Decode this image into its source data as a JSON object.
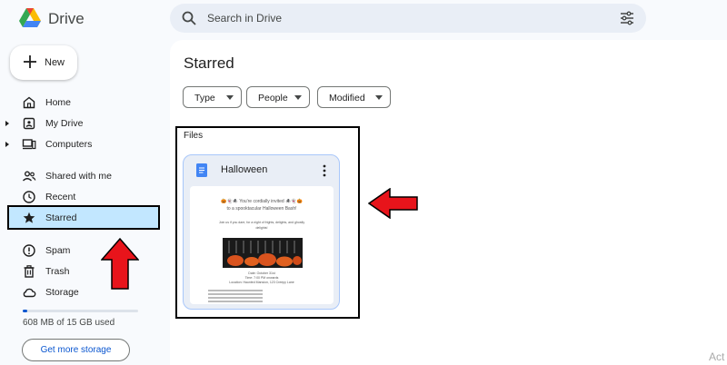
{
  "app": {
    "brand": "Drive"
  },
  "search": {
    "placeholder": "Search in Drive"
  },
  "sidebar": {
    "new_label": "New",
    "items": [
      {
        "label": "Home",
        "icon": "home-icon"
      },
      {
        "label": "My Drive",
        "icon": "my-drive-icon"
      },
      {
        "label": "Computers",
        "icon": "computers-icon"
      },
      {
        "label": "Shared with me",
        "icon": "shared-icon"
      },
      {
        "label": "Recent",
        "icon": "clock-icon"
      },
      {
        "label": "Starred",
        "icon": "star-icon",
        "active": true
      },
      {
        "label": "Spam",
        "icon": "spam-icon"
      },
      {
        "label": "Trash",
        "icon": "trash-icon"
      },
      {
        "label": "Storage",
        "icon": "cloud-icon"
      }
    ],
    "storage": {
      "used_text": "608 MB of 15 GB used",
      "used_fraction": 0.04,
      "button_label": "Get more storage"
    }
  },
  "main": {
    "title": "Starred",
    "filters": [
      "Type",
      "People",
      "Modified"
    ],
    "section_label": "Files",
    "file": {
      "name": "Halloween",
      "preview": {
        "heading_line1": "🎃👻🕷️ You're cordially invited 🕷️👻🎃",
        "heading_line2": "to a spooktacular Halloween Bash!",
        "intro_line1": "Join us if you dare, for a night of frights, delights, and ghostly",
        "intro_line2": "delights!",
        "date": "Date: October 31st",
        "time": "Time: 7:00 PM onwards",
        "location": "Location: Haunted Mansion, 123 Creepy Lane"
      }
    }
  },
  "watermark": "Act",
  "colors": {
    "accent": "#0b57d0",
    "active_bg": "#c2e7ff",
    "arrow": "#e8141b"
  }
}
